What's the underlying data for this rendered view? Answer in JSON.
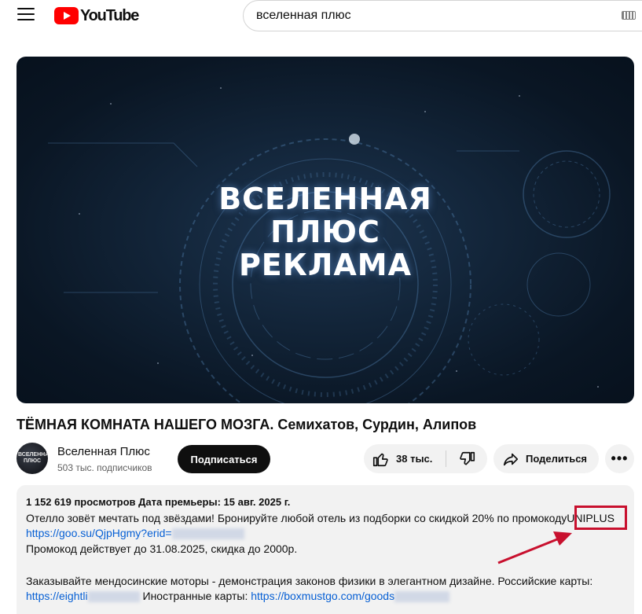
{
  "header": {
    "logo_text": "YouTube",
    "search_value": "вселенная плюс",
    "icons": [
      "menu-icon",
      "youtube-logo-icon",
      "keyboard-icon"
    ]
  },
  "player": {
    "title_lines": [
      "ВСЕЛЕННАЯ",
      "ПЛЮС",
      "РЕКЛАМА"
    ]
  },
  "video": {
    "title": "ТЁМНАЯ КОМНАТА НАШЕГО МОЗГА. Семихатов, Сурдин, Алипов"
  },
  "channel": {
    "avatar_text": "ВСЕЛЕННАЯ ПЛЮС",
    "name": "Вселенная Плюс",
    "subscribers": "503 тыс. подписчиков",
    "subscribe_label": "Подписаться"
  },
  "actions": {
    "likes": "38 тыс.",
    "share_label": "Поделиться",
    "more_label": "•••"
  },
  "description": {
    "meta": "1 152 619 просмотров  Дата премьеры: 15 авг. 2025 г.",
    "line1": "Отелло зовёт мечтать под звёздами! Бронируйте любой отель из подборки со скидкой 20% по промокоду",
    "promo_code": "UNIPLUS",
    "link1": "https://goo.su/QjpHgmy?erid=",
    "line3": "Промокод действует до 31.08.2025, скидка до 2000р.",
    "line5": "Заказывайте мендосинские моторы - демонстрация законов физики в элегантном дизайне. Российские карты:",
    "link2": "https://eightli",
    "foreign_label": "Иностранные карты:",
    "link3": "https://boxmustgo.com/goods"
  },
  "colors": {
    "accent_red": "#ff0000",
    "annotation_red": "#c8102e",
    "link_blue": "#065fd4",
    "chip_bg": "#f2f2f2"
  }
}
